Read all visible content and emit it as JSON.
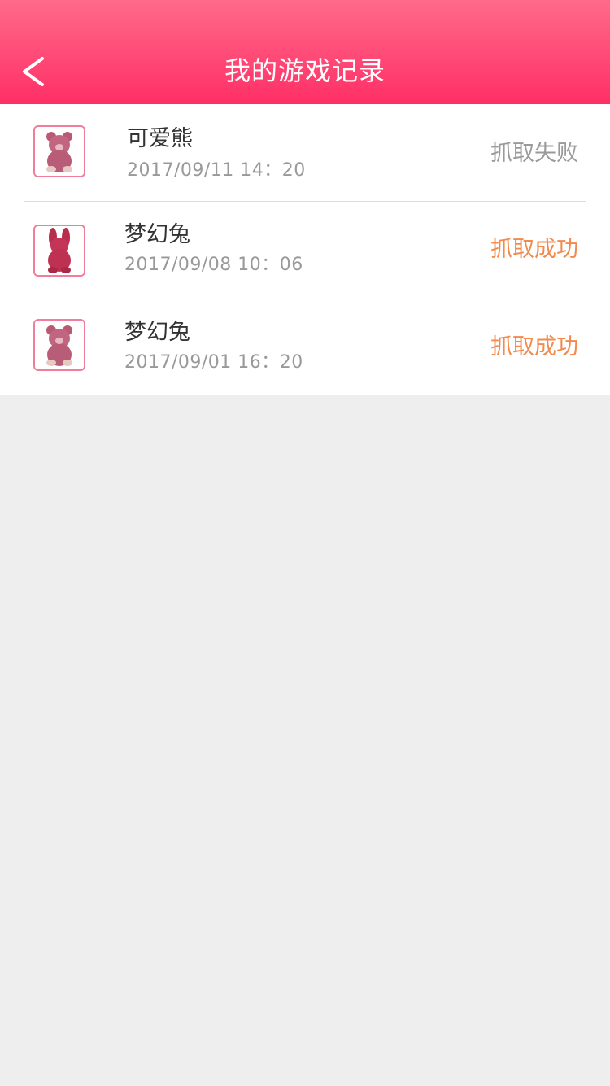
{
  "header": {
    "title": "我的游戏记录",
    "back_icon": "chevron-left-icon",
    "gradient_top": "#ff6a8a",
    "gradient_bottom": "#ff2f66"
  },
  "records": [
    {
      "name": "可爱熊",
      "time": "2017/09/11 14：20",
      "status": "抓取失败",
      "status_type": "fail",
      "thumb_icon": "bear-toy-icon"
    },
    {
      "name": "梦幻兔",
      "time": "2017/09/08 10：06",
      "status": "抓取成功",
      "status_type": "success",
      "thumb_icon": "bunny-toy-icon"
    },
    {
      "name": "梦幻兔",
      "time": "2017/09/01 16：20",
      "status": "抓取成功",
      "status_type": "success",
      "thumb_icon": "bear-toy-icon"
    }
  ],
  "colors": {
    "status_fail": "#9a9a9a",
    "status_success": "#f28a4c",
    "thumb_border": "#ef7d9b",
    "page_background": "#eeeeee"
  }
}
